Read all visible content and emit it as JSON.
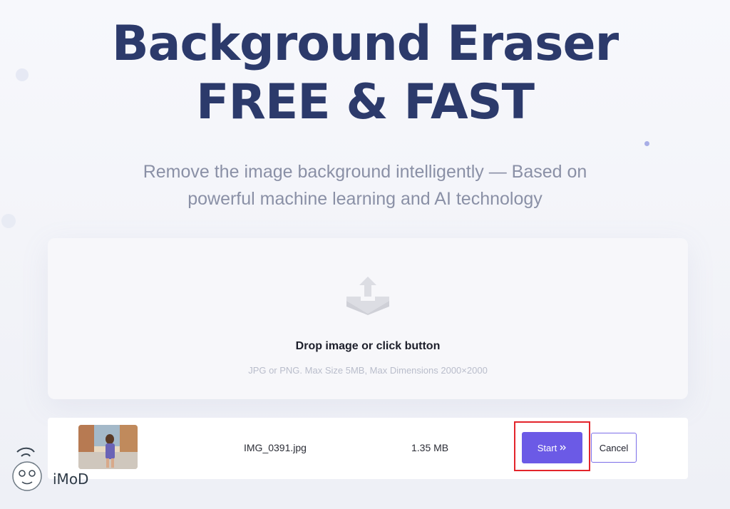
{
  "hero": {
    "title_line1": "Background Eraser",
    "title_line2": "FREE & FAST",
    "subtitle_line1": "Remove the image background intelligently — Based on",
    "subtitle_line2": "powerful machine learning and AI technology"
  },
  "dropzone": {
    "icon": "upload-icon",
    "title": "Drop image or click button",
    "hint": "JPG or PNG. Max Size 5MB, Max Dimensions 2000×2000"
  },
  "file": {
    "name": "IMG_0391.jpg",
    "size": "1.35 MB",
    "start_label": "Start",
    "start_icon": "double-chevron-right-icon",
    "cancel_label": "Cancel"
  },
  "watermark": {
    "text": "iMoD"
  },
  "colors": {
    "title": "#2c3a6b",
    "accent": "#6b5ae6",
    "highlight": "#e3242b"
  }
}
